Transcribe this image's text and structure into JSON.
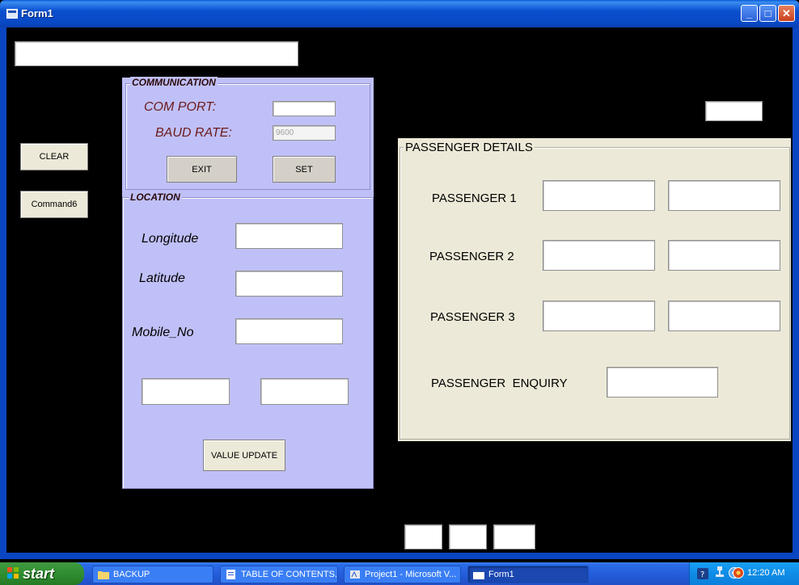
{
  "window": {
    "title": "Form1"
  },
  "form": {
    "top_textbox": "",
    "top_right_textbox": "",
    "clear_button": "CLEAR",
    "command6_button": "Command6"
  },
  "communication": {
    "group_label": "COMMUNICATION",
    "com_port_label": "COM PORT:",
    "com_port_value": "",
    "baud_rate_label": "BAUD RATE:",
    "baud_rate_value": "9600",
    "exit_button": "EXIT",
    "set_button": "SET"
  },
  "location": {
    "group_label": "LOCATION",
    "longitude_label": "Longitude",
    "longitude_value": "",
    "latitude_label": "Latitude",
    "latitude_value": "",
    "mobile_label": "Mobile_No",
    "mobile_value": "",
    "extra_value_1": "",
    "extra_value_2": "",
    "value_update_button": "VALUE UPDATE"
  },
  "passenger": {
    "group_label": "PASSENGER DETAILS",
    "rows": [
      {
        "label": "PASSENGER 1",
        "value_a": "",
        "value_b": ""
      },
      {
        "label": "PASSENGER 2",
        "value_a": "",
        "value_b": ""
      },
      {
        "label": "PASSENGER 3",
        "value_a": "",
        "value_b": ""
      }
    ],
    "enquiry_label": "PASSENGER  ENQUIRY",
    "enquiry_value": ""
  },
  "bottom_boxes": [
    "",
    "",
    ""
  ],
  "taskbar": {
    "start_label": "start",
    "items": [
      {
        "label": "BACKUP",
        "icon": "folder-icon"
      },
      {
        "label": "TABLE OF CONTENTS...",
        "icon": "document-icon"
      },
      {
        "label": "Project1 - Microsoft V...",
        "icon": "vb-project-icon"
      },
      {
        "label": "Form1",
        "icon": "form-window-icon"
      }
    ],
    "clock": "12:20 AM"
  },
  "colors": {
    "panel_purple": "#c0c0f8",
    "panel_beige": "#ece9d8",
    "form_background": "#000000",
    "title_blue": "#0a4fd0"
  }
}
